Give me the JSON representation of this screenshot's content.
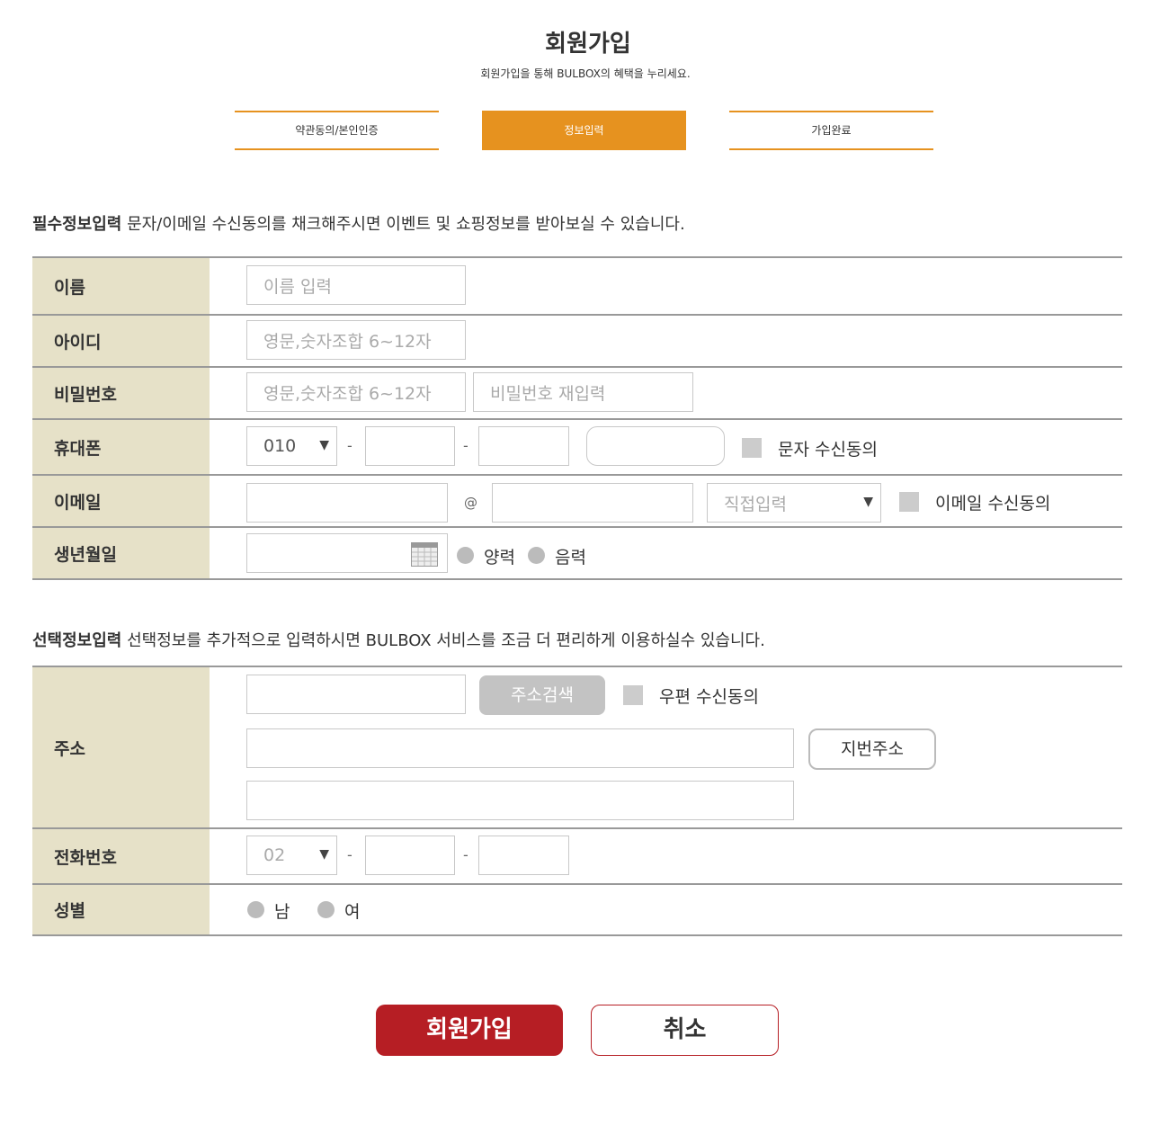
{
  "header": {
    "title": "회원가입",
    "subtitle": "회원가입을 통해 BULBOX의 혜택을 누리세요."
  },
  "steps": [
    {
      "label": "약관동의/본인인증",
      "active": false
    },
    {
      "label": "정보입력",
      "active": true
    },
    {
      "label": "가입완료",
      "active": false
    }
  ],
  "required": {
    "heading_bold": "필수정보입력",
    "heading_text": " 문자/이메일 수신동의를 채크해주시면 이벤트 및 쇼핑정보를 받아보실 수 있습니다.",
    "name": {
      "label": "이름",
      "placeholder": "이름 입력"
    },
    "userid": {
      "label": "아이디",
      "placeholder": "영문,숫자조합 6~12자"
    },
    "password": {
      "label": "비밀번호",
      "placeholder": "영문,숫자조합 6~12자",
      "confirm_placeholder": "비밀번호 재입력"
    },
    "mobile": {
      "label": "휴대폰",
      "prefix": "010",
      "dash": "-",
      "sms_consent": "문자 수신동의"
    },
    "email": {
      "label": "이메일",
      "at": "@",
      "domain_select": "직접입력",
      "email_consent": "이메일 수신동의"
    },
    "birth": {
      "label": "생년월일",
      "solar": "양력",
      "lunar": "음력"
    }
  },
  "optional": {
    "heading_bold": "선택정보입력",
    "heading_text": " 선택정보를 추가적으로 입력하시면 BULBOX 서비스를 조금 더 편리하게 이용하실수 있습니다.",
    "address": {
      "label": "주소",
      "search_button": "주소검색",
      "mail_consent": "우편 수신동의",
      "jibun_button": "지번주소"
    },
    "phone": {
      "label": "전화번호",
      "prefix": "02",
      "dash": "-"
    },
    "gender": {
      "label": "성별",
      "male": "남",
      "female": "여"
    }
  },
  "buttons": {
    "join": "회원가입",
    "cancel": "취소"
  },
  "colors": {
    "accent_orange": "#e6921f",
    "label_bg": "#e6e1c8",
    "brand_red": "#b61e24"
  }
}
